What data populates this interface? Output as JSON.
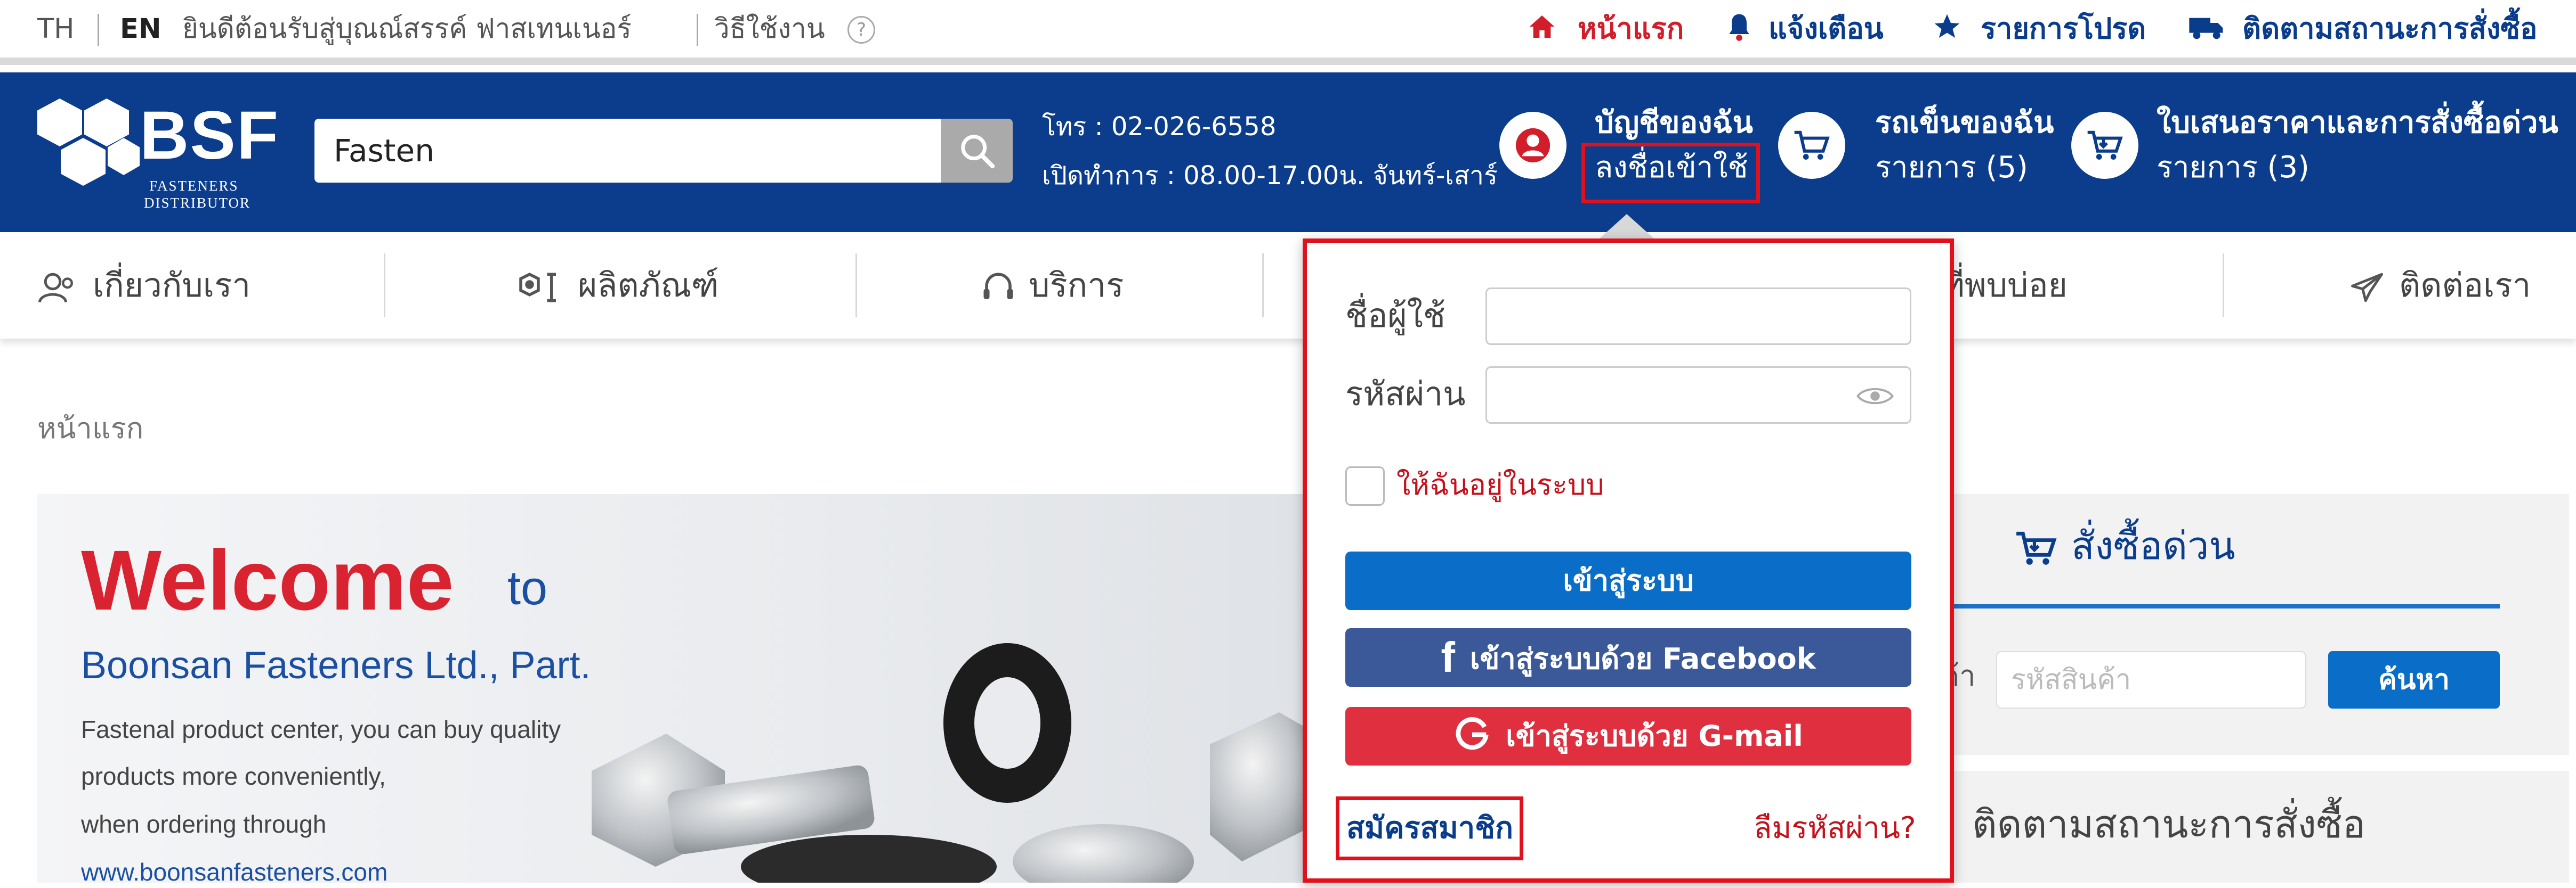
{
  "topbar": {
    "lang_th": "TH",
    "lang_en": "EN",
    "welcome_text": "ยินดีต้อนรับสู่บุณณ์สรรค์ ฟาสเทนเนอร์",
    "how_to": "วิธีใช้งาน",
    "help_glyph": "?",
    "links": {
      "home": "หน้าแรก",
      "notify": "แจ้งเตือน",
      "favorites": "รายการโปรด",
      "track": "ติดตามสถานะการสั่งซื้อ"
    }
  },
  "header": {
    "logo_text": "BSF",
    "logo_sub1": "FASTENERS",
    "logo_sub2": "DISTRIBUTOR",
    "search_value": "Fasten",
    "phone": "โทร : 02-026-6558",
    "hours": "เปิดทำการ : 08.00-17.00น. จันทร์-เสาร์",
    "account_title": "บัญชีของฉัน",
    "account_login": "ลงชื่อเข้าใช้",
    "cart_title": "รถเข็นของฉัน",
    "cart_count": "รายการ (5)",
    "quote_title": "ใบเสนอราคาและการสั่งซื้อด่วน",
    "quote_count": "รายการ (3)"
  },
  "nav": {
    "about": "เกี่ยวกับเรา",
    "products": "ผลิตภัณฑ์",
    "services": "บริการ",
    "faq": "ที่พบบ่อย",
    "contact": "ติดต่อเรา"
  },
  "breadcrumb": "หน้าแรก",
  "banner": {
    "welcome": "Welcome",
    "to": "to",
    "company": "Boonsan Fasteners Ltd., Part.",
    "line1": "Fastenal product center, you can buy quality",
    "line2": "products more conveniently,",
    "line3": "when ordering through",
    "website": "www.boonsanfasteners.com"
  },
  "quick_order": {
    "title": "สั่งซื้อด่วน",
    "label_partial": "ค้า",
    "placeholder": "รหัสสินค้า",
    "search_button": "ค้นหา"
  },
  "track_order": {
    "title": "ติดตามสถานะการสั่งซื้อ"
  },
  "login_dropdown": {
    "username_label": "ชื่อผู้ใช้",
    "password_label": "รหัสผ่าน",
    "remember_label": "ให้ฉันอยู่ในระบบ",
    "login_button": "เข้าสู่ระบบ",
    "facebook_button": "เข้าสู่ระบบด้วย Facebook",
    "gmail_button": "เข้าสู่ระบบด้วย G-mail",
    "register_link": "สมัครสมาชิก",
    "forgot_link": "ลืมรหัสผ่าน?"
  },
  "colors": {
    "brand_blue": "#0b3d8c",
    "accent_red": "#d21d2a",
    "login_blue": "#0a6ec8",
    "facebook_blue": "#3b5998",
    "gmail_red": "#e03040"
  }
}
